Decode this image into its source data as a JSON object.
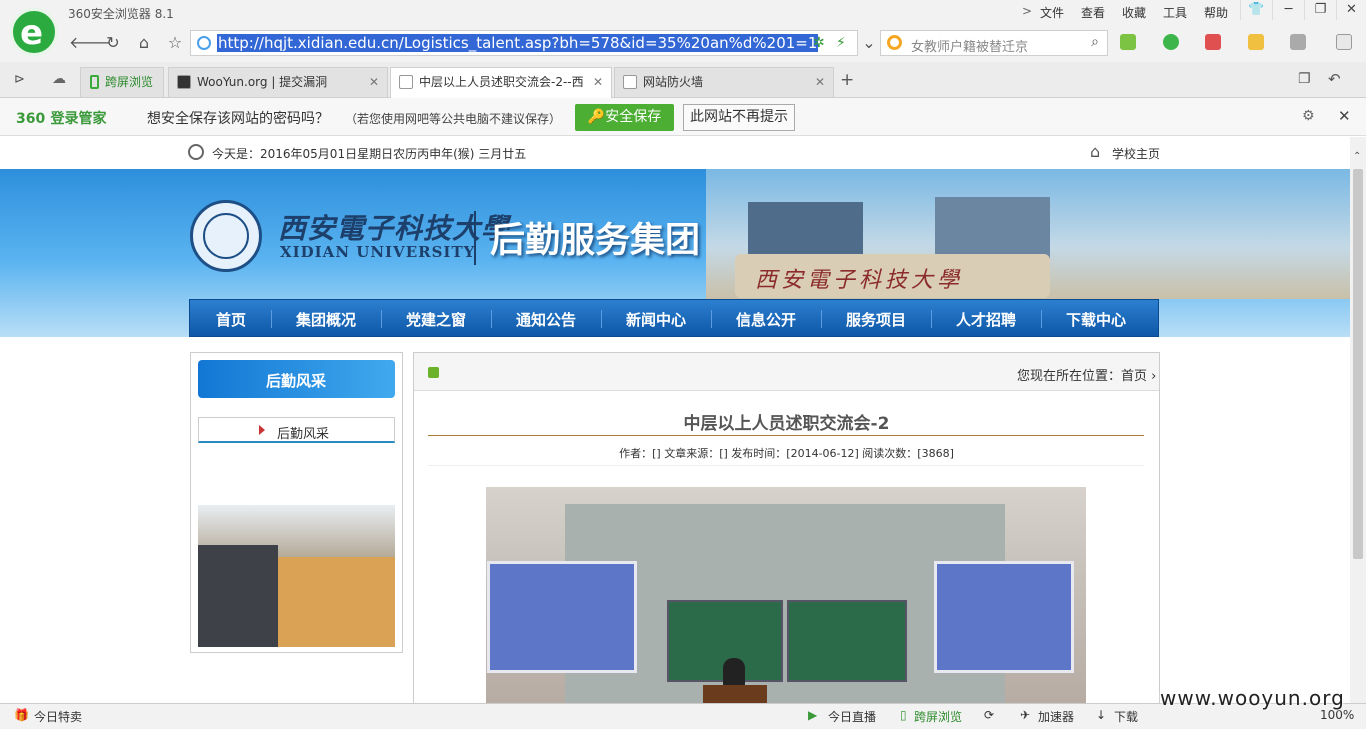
{
  "browser": {
    "app_title": "360安全浏览器 8.1",
    "menu": [
      "文件",
      "查看",
      "收藏",
      "工具",
      "帮助"
    ],
    "url": "http://hqjt.xidian.edu.cn/Logistics_talent.asp?bh=578&id=35%20an%d%201=1",
    "search_text": "女教师户籍被替迁京"
  },
  "tabs": [
    {
      "label": "跨屏浏览",
      "active": false
    },
    {
      "label": "WooYun.org | 提交漏洞",
      "active": false
    },
    {
      "label": "中层以上人员述职交流会-2--西",
      "active": true
    },
    {
      "label": "网站防火墙",
      "active": false
    }
  ],
  "password_bar": {
    "brand": "360",
    "brand_sub": "登录管家",
    "question": "想安全保存该网站的密码吗？",
    "note": "（若您使用网吧等公共电脑不建议保存）",
    "save_label": "安全保存",
    "no_more_label": "此网站不再提示"
  },
  "site": {
    "date_text": "今天是：2016年05月01日星期日农历丙申年(猴) 三月廿五",
    "home_link": "学校主页",
    "university_cn": "西安電子科技大學",
    "university_en": "XIDIAN UNIVERSITY",
    "department": "后勤服务集团",
    "stone_text": "西安電子科技大學",
    "nav": [
      "首页",
      "集团概况",
      "党建之窗",
      "通知公告",
      "新闻中心",
      "信息公开",
      "服务项目",
      "人才招聘",
      "下载中心"
    ],
    "sidebar_title": "后勤风采",
    "sidebar_item": "后勤风采",
    "breadcrumb": "您现在所在位置：首页",
    "article": {
      "title": "中层以上人员述职交流会-2",
      "meta": "作者：[] 文章来源：[] 发布时间：[2014-06-12] 阅读次数：[3868]"
    }
  },
  "status": {
    "left": "今日特卖",
    "live": "今日直播",
    "cross": "跨屏浏览",
    "speed": "加速器",
    "download": "下载",
    "zoom": "100%"
  },
  "watermark": "www.wooyun.org"
}
